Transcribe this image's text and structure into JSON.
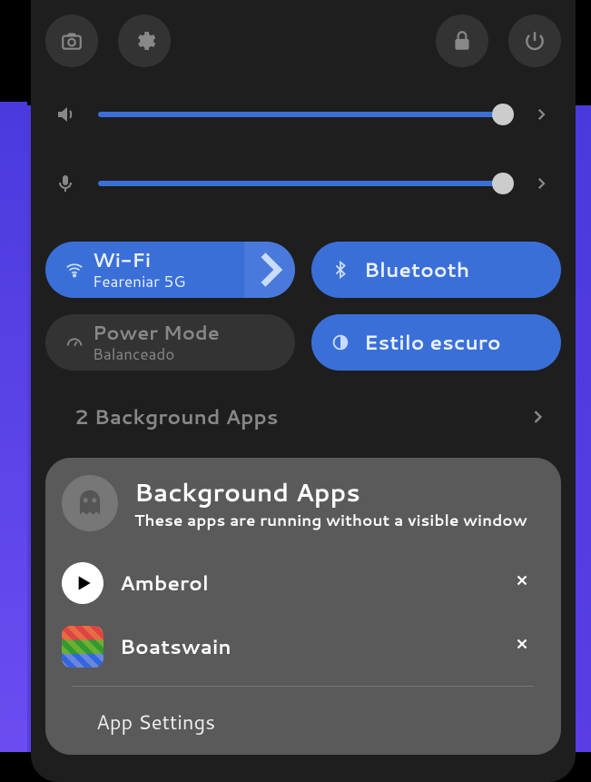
{
  "sliders": {
    "volume": {
      "value": 100
    },
    "mic": {
      "value": 100
    }
  },
  "toggles": {
    "wifi": {
      "title": "Wi-Fi",
      "sub": "Feareniar 5G",
      "active": true,
      "has_sub": true,
      "has_chev": true
    },
    "bluetooth": {
      "title": "Bluetooth",
      "active": true,
      "has_sub": false,
      "has_chev": false
    },
    "power": {
      "title": "Power Mode",
      "sub": "Balanceado",
      "active": false,
      "has_sub": true,
      "has_chev": false
    },
    "darkstyle": {
      "title": "Estilo escuro",
      "active": true,
      "has_sub": false,
      "has_chev": false
    }
  },
  "bg_row": {
    "label": "2 Background Apps"
  },
  "popover": {
    "title": "Background Apps",
    "subtitle": "These apps are running without a visible window",
    "apps": [
      {
        "name": "Amberol"
      },
      {
        "name": "Boatswain"
      }
    ],
    "settings_label": "App Settings"
  }
}
